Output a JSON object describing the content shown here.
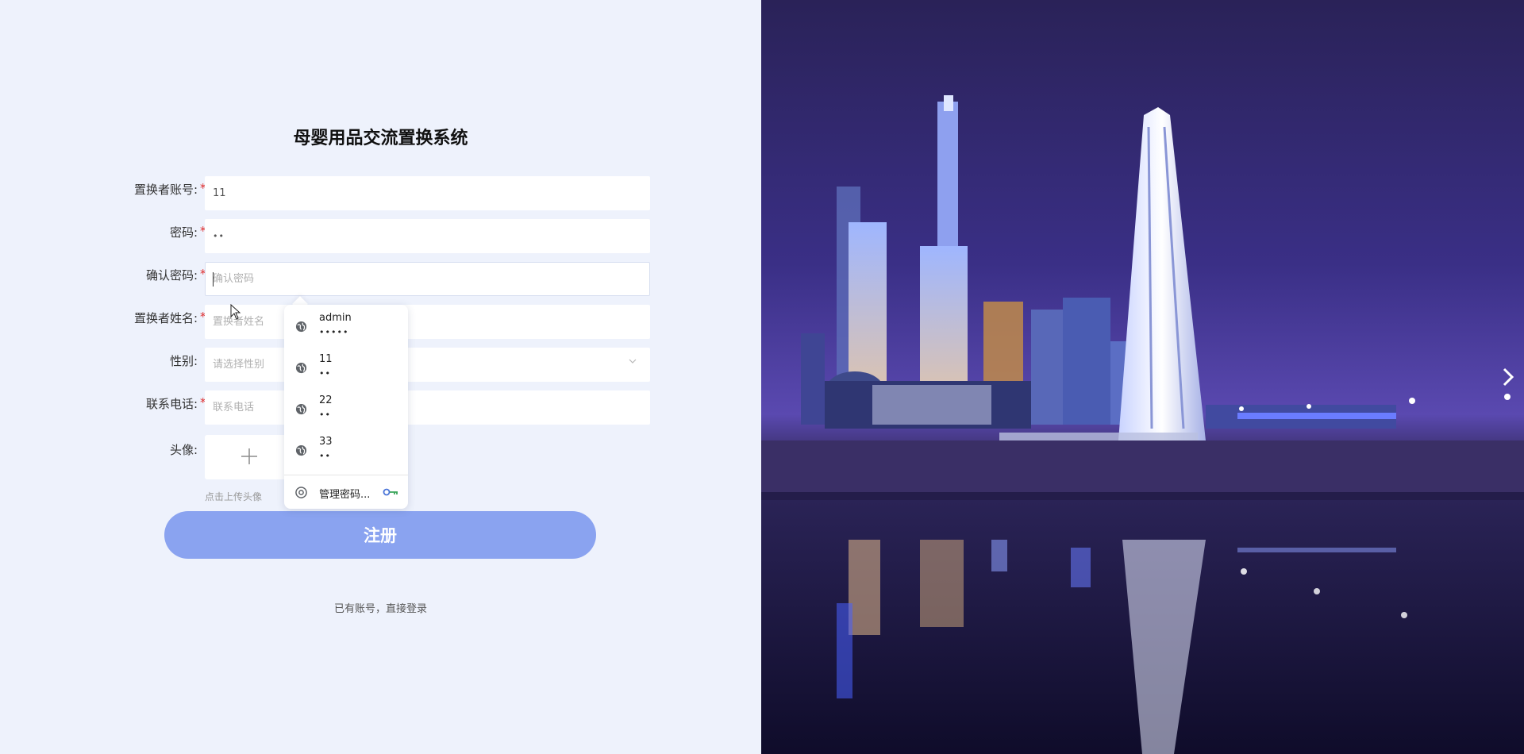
{
  "page": {
    "title": "母婴用品交流置换系统"
  },
  "form": {
    "account": {
      "label": "置换者账号:",
      "value": "11",
      "placeholder": "置换者账号"
    },
    "password": {
      "label": "密码:",
      "value": "••",
      "placeholder": "密码"
    },
    "confirm_password": {
      "label": "确认密码:",
      "value": "",
      "placeholder": "确认密码"
    },
    "name": {
      "label": "置换者姓名:",
      "value": "",
      "placeholder": "置换者姓名"
    },
    "gender": {
      "label": "性别:",
      "placeholder": "请选择性别"
    },
    "phone": {
      "label": "联系电话:",
      "value": "",
      "placeholder": "联系电话"
    },
    "avatar": {
      "label": "头像:",
      "hint": "点击上传头像"
    },
    "required_mark": "*",
    "register_button": "注册",
    "login_link": "已有账号，直接登录"
  },
  "autofill": {
    "items": [
      {
        "username": "admin",
        "password": "•••••"
      },
      {
        "username": "11",
        "password": "••"
      },
      {
        "username": "22",
        "password": "••"
      },
      {
        "username": "33",
        "password": "••"
      }
    ],
    "manage_label": "管理密码..."
  },
  "colors": {
    "page_bg": "#eef2fc",
    "button_bg": "#8aa3f0",
    "required": "#e0302f"
  },
  "icons": [
    "globe-icon",
    "chrome-icon",
    "key-icon",
    "plus-icon",
    "chevron-down-icon",
    "chevron-right-icon",
    "mouse-cursor-icon"
  ]
}
